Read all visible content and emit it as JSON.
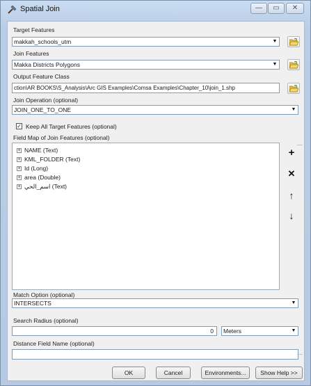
{
  "window": {
    "title": "Spatial Join",
    "min_glyph": "—",
    "max_glyph": "▭",
    "close_glyph": "✕"
  },
  "target_features": {
    "label": "Target Features",
    "value": "makkah_schools_utm"
  },
  "join_features": {
    "label": "Join Features",
    "value": "Makka Districts Polygons"
  },
  "output_feature_class": {
    "label": "Output Feature Class",
    "value": "ction\\AR BOOKS\\S_Analysis\\Arc GIS Examples\\Comsa Examples\\Chapter_10\\join_1.shp"
  },
  "join_operation": {
    "label": "Join Operation (optional)",
    "value": "JOIN_ONE_TO_ONE"
  },
  "keep_all": {
    "label": "Keep All Target Features (optional)",
    "checked_glyph": "✓"
  },
  "field_map": {
    "label": "Field Map of Join Features (optional)",
    "expander": "+",
    "items": [
      "NAME (Text)",
      "KML_FOLDER (Text)",
      "Id (Long)",
      "area (Double)",
      "اسم_الحي (Text)"
    ],
    "buttons": {
      "add": "+",
      "remove": "✕",
      "up": "↑",
      "down": "↓"
    }
  },
  "match_option": {
    "label": "Match Option (optional)",
    "value": "INTERSECTS"
  },
  "search_radius": {
    "label": "Search Radius (optional)",
    "value": "0",
    "unit": "Meters"
  },
  "distance_field": {
    "label": "Distance Field Name (optional)",
    "value": ""
  },
  "buttons": {
    "ok": "OK",
    "cancel": "Cancel",
    "environments": "Environments...",
    "show_help": "Show Help >>"
  }
}
